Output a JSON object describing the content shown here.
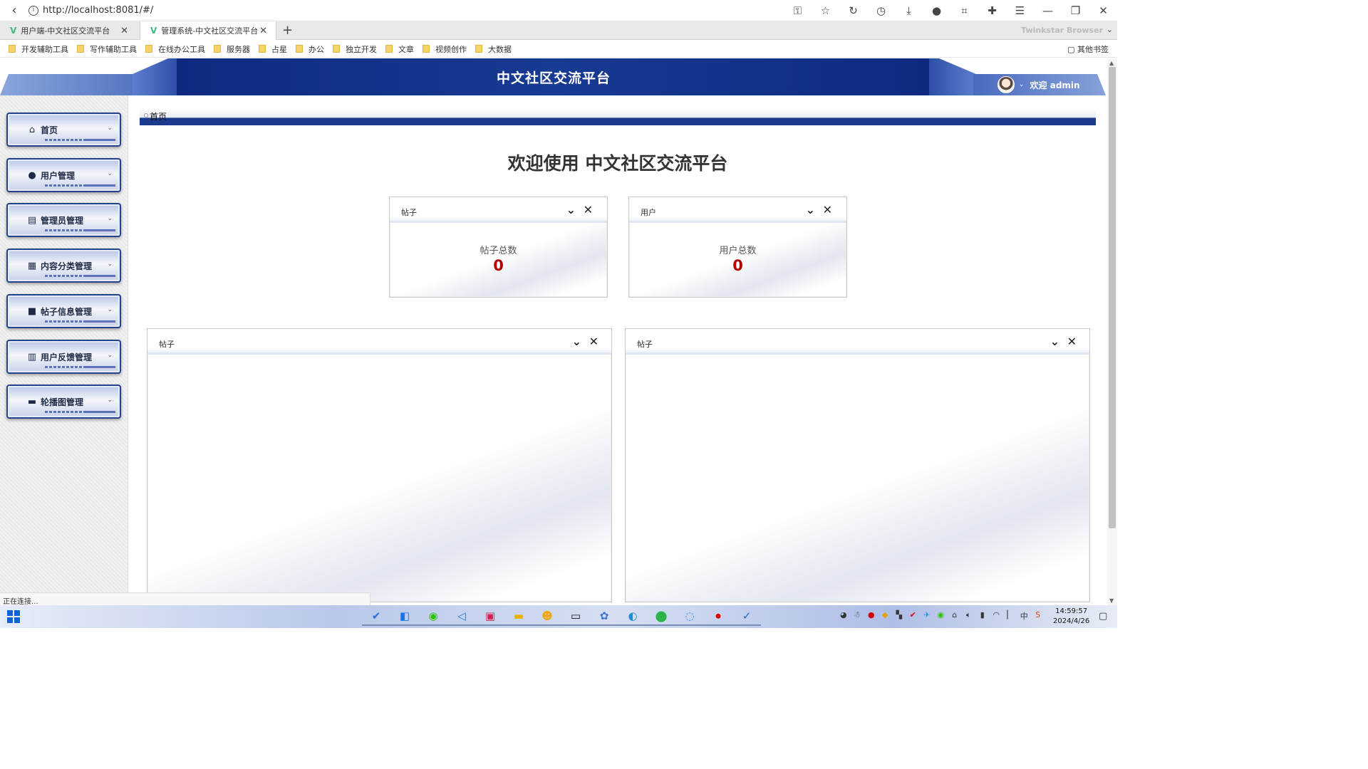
{
  "browser": {
    "url": "http://localhost:8081/#/",
    "tabs": [
      {
        "label": "用户端-中文社区交流平台"
      },
      {
        "label": "管理系统-中文社区交流平台"
      }
    ],
    "brand": "Twinkstar Browser",
    "bookmarks": [
      "开发辅助工具",
      "写作辅助工具",
      "在线办公工具",
      "服务器",
      "占星",
      "办公",
      "独立开发",
      "文章",
      "视频创作",
      "大数据"
    ],
    "other_bookmarks": "其他书签",
    "status_text": "正在连接..."
  },
  "header": {
    "title": "中文社区交流平台",
    "user_greeting": "欢迎 admin"
  },
  "sidebar": {
    "items": [
      {
        "label": "首页",
        "icon": "home-icon"
      },
      {
        "label": "用户管理",
        "icon": "user-icon"
      },
      {
        "label": "管理员管理",
        "icon": "table-icon"
      },
      {
        "label": "内容分类管理",
        "icon": "grid-icon"
      },
      {
        "label": "帖子信息管理",
        "icon": "book-icon"
      },
      {
        "label": "用户反馈管理",
        "icon": "book-icon"
      },
      {
        "label": "轮播图管理",
        "icon": "card-icon"
      }
    ]
  },
  "breadcrumb": {
    "current": "首页"
  },
  "main": {
    "welcome": "欢迎使用 中文社区交流平台",
    "stat_cards": [
      {
        "title": "帖子",
        "label": "帖子总数",
        "value": "0"
      },
      {
        "title": "用户",
        "label": "用户总数",
        "value": "0"
      }
    ],
    "chart_cards": [
      {
        "title": "帖子"
      },
      {
        "title": "帖子"
      }
    ]
  },
  "taskbar": {
    "time": "14:59:57",
    "date": "2024/4/26"
  }
}
